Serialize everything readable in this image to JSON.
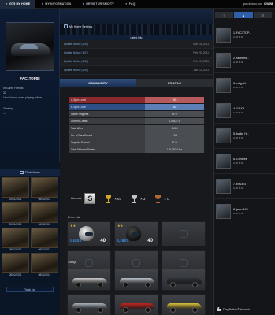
{
  "nav": {
    "tabs": [
      {
        "label": "GT5 MY HOME",
        "active": true
      },
      {
        "label": "MY INFORMATION",
        "active": false
      },
      {
        "label": "NEWS TURISMO TV",
        "active": false
      },
      {
        "label": "FAQ",
        "active": false
      }
    ],
    "user_email": "gran.turismo.com",
    "user_action": "ONLINE"
  },
  "profile": {
    "username": "FAC1TOP88",
    "stats": [
      "In-Game Friends",
      "32",
      "Usual hours when playing online",
      "",
      "Greeting",
      "---"
    ],
    "photo_list_label": "Photo Album",
    "photos": [
      {
        "date": "20/01/2011"
      },
      {
        "date": "08/02/2011"
      },
      {
        "date": "20/01/2011"
      },
      {
        "date": "08/02/2011"
      },
      {
        "date": "08/02/2011"
      },
      {
        "date": "08/02/2011"
      },
      {
        "date": "08/02/2011"
      },
      {
        "date": "08/02/2011"
      }
    ],
    "track_list_label": "Track List"
  },
  "center": {
    "home_settings_label": "My Home Settings",
    "latest_info_label": "Latest Info",
    "info_rows": [
      {
        "title": "Update Notice (1.09)",
        "date": "Mar 15, 2011"
      },
      {
        "title": "Update Notice (1.07)",
        "date": "Feb 25, 2011"
      },
      {
        "title": "Update Notice (1.06)",
        "date": "Feb 10, 2011"
      },
      {
        "title": "Update Notice (1.05)",
        "date": "Jan 12, 2011"
      }
    ],
    "tabs": [
      {
        "label": "COMMUNITY",
        "active": true
      },
      {
        "label": "PROFILE",
        "active": false
      }
    ],
    "specs": [
      {
        "label": "A-Spec Level",
        "value": "40",
        "style": "red"
      },
      {
        "label": "B-Spec Level",
        "value": "40",
        "style": "blue"
      },
      {
        "label": "Game Progress",
        "value": "96 %",
        "style": ""
      },
      {
        "label": "Current Credits",
        "value": "6,506,471",
        "style": ""
      },
      {
        "label": "Total Wins",
        "value": "1,063",
        "style": ""
      },
      {
        "label": "No. of Cars Owned",
        "value": "196",
        "style": ""
      },
      {
        "label": "Trophies Earned",
        "value": "81 %",
        "style": ""
      },
      {
        "label": "Total Distance Driven",
        "value": "129,150.3 km",
        "style": ""
      }
    ],
    "licenses_label": "Licenses",
    "license_badge": "S",
    "trophies": [
      {
        "kind": "gold",
        "count": "× 57"
      },
      {
        "kind": "silver",
        "count": "× 3"
      },
      {
        "kind": "bronze",
        "count": "× 0"
      }
    ],
    "driver_list_label": "Driver List",
    "drivers": [
      {
        "stars": "★★",
        "class_label": "Class",
        "level": "40",
        "variant": "a"
      },
      {
        "stars": "★★",
        "class_label": "Class",
        "level": "40",
        "variant": "b"
      }
    ],
    "garage_label": "Garage",
    "garage_cars": [
      {
        "color": "#c9c9c9"
      },
      {
        "color": "#b7c0cc"
      },
      {
        "color": "#2c2f35"
      },
      {
        "color": "#a8b0ba"
      },
      {
        "color": "#c2251f"
      },
      {
        "color": "#d9c23a"
      }
    ]
  },
  "friends": {
    "tabs": [
      "≡",
      "▲",
      "☰"
    ],
    "list": [
      {
        "name": "1. FAC1TOP...",
        "meta": "A:40 B:40"
      },
      {
        "name": "2. raketred...",
        "meta": "A:40 B:40"
      },
      {
        "name": "3. edgy84",
        "meta": "A:40 B:40"
      },
      {
        "name": "4. GSXR...",
        "meta": "A:40 B:40"
      },
      {
        "name": "5. bailio_H...",
        "meta": "A:40 B:40"
      },
      {
        "name": "6. Greaves",
        "meta": "A:40 B:40"
      },
      {
        "name": "7. Kev323",
        "meta": "A:40 B:40"
      },
      {
        "name": "8. jaden109",
        "meta": "A:40 B:40"
      }
    ]
  },
  "footer": {
    "psn": "PlayStation®Network"
  }
}
